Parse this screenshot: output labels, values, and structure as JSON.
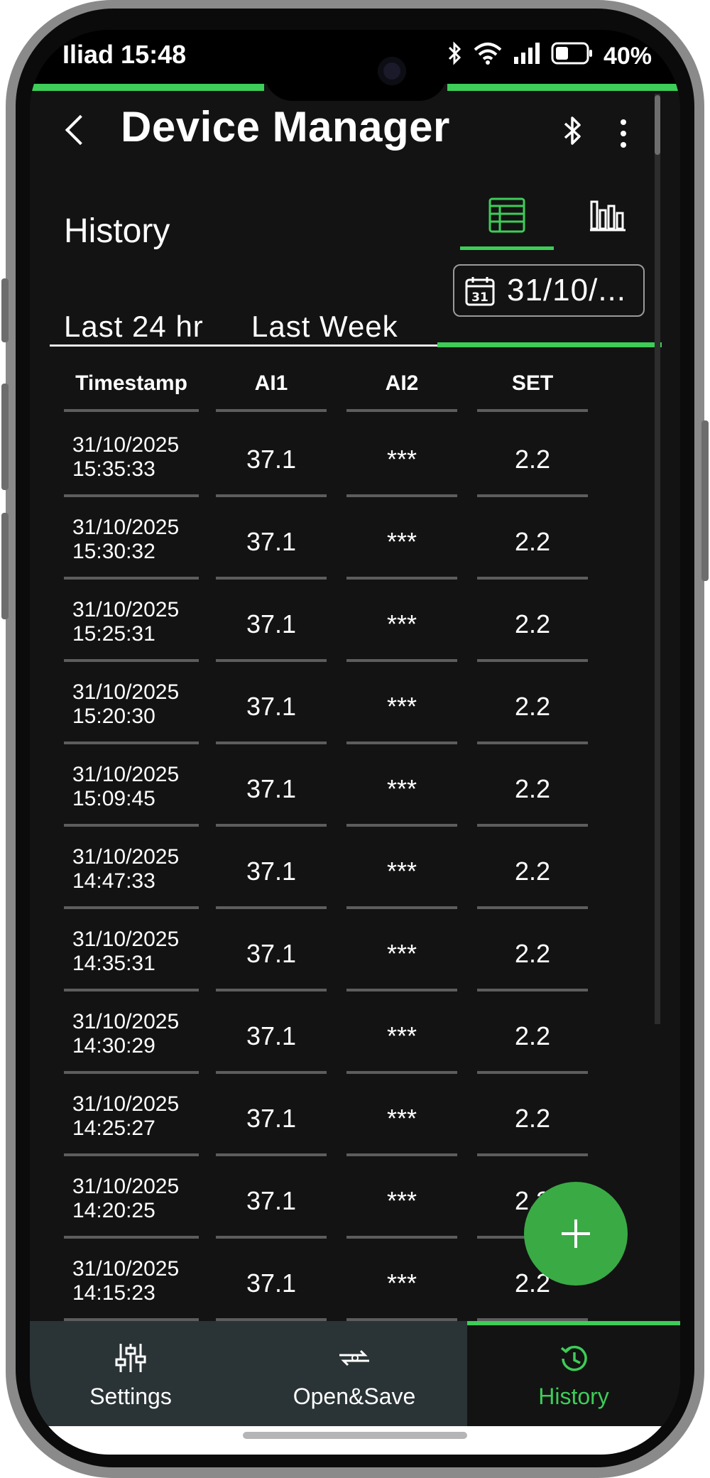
{
  "status": {
    "carrier": "Iliad",
    "time": "15:48",
    "battery": "40%"
  },
  "header": {
    "title": "Device Manager"
  },
  "history": {
    "title": "History"
  },
  "range_tabs": {
    "last24": "Last 24 hr",
    "last_week": "Last Week",
    "date": "31/10/...",
    "calendar_day": "31"
  },
  "table": {
    "columns": [
      "Timestamp",
      "AI1",
      "AI2",
      "SET"
    ],
    "rows": [
      {
        "date": "31/10/2025",
        "time": "15:35:33",
        "ai1": "37.1",
        "ai2": "***",
        "set": "2.2"
      },
      {
        "date": "31/10/2025",
        "time": "15:30:32",
        "ai1": "37.1",
        "ai2": "***",
        "set": "2.2"
      },
      {
        "date": "31/10/2025",
        "time": "15:25:31",
        "ai1": "37.1",
        "ai2": "***",
        "set": "2.2"
      },
      {
        "date": "31/10/2025",
        "time": "15:20:30",
        "ai1": "37.1",
        "ai2": "***",
        "set": "2.2"
      },
      {
        "date": "31/10/2025",
        "time": "15:09:45",
        "ai1": "37.1",
        "ai2": "***",
        "set": "2.2"
      },
      {
        "date": "31/10/2025",
        "time": "14:47:33",
        "ai1": "37.1",
        "ai2": "***",
        "set": "2.2"
      },
      {
        "date": "31/10/2025",
        "time": "14:35:31",
        "ai1": "37.1",
        "ai2": "***",
        "set": "2.2"
      },
      {
        "date": "31/10/2025",
        "time": "14:30:29",
        "ai1": "37.1",
        "ai2": "***",
        "set": "2.2"
      },
      {
        "date": "31/10/2025",
        "time": "14:25:27",
        "ai1": "37.1",
        "ai2": "***",
        "set": "2.2"
      },
      {
        "date": "31/10/2025",
        "time": "14:20:25",
        "ai1": "37.1",
        "ai2": "***",
        "set": "2.2"
      },
      {
        "date": "31/10/2025",
        "time": "14:15:23",
        "ai1": "37.1",
        "ai2": "***",
        "set": "2.2"
      }
    ]
  },
  "fab": {
    "label": "+"
  },
  "bottom_nav": {
    "settings": "Settings",
    "open_save": "Open&Save",
    "history": "History"
  },
  "colors": {
    "accent": "#3dcd58",
    "fab": "#3aaa45",
    "background": "#131313",
    "nav_background": "#2a3335"
  },
  "icons": [
    "back-icon",
    "bluetooth-icon",
    "more-vert-icon",
    "table-view-icon",
    "chart-view-icon",
    "calendar-icon",
    "settings-sliders-icon",
    "open-save-icon",
    "history-icon",
    "plus-icon",
    "wifi-icon",
    "signal-icon",
    "battery-icon"
  ]
}
